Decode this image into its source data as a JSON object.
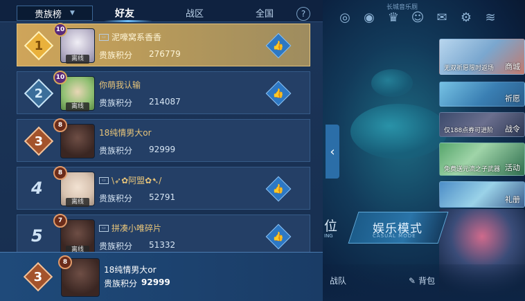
{
  "header": {
    "dropdown_label": "贵族榜",
    "tabs": [
      {
        "label": "好友",
        "active": true
      },
      {
        "label": "战区",
        "active": false
      },
      {
        "label": "全国",
        "active": false
      }
    ],
    "help_label": "?"
  },
  "rows": [
    {
      "rank": "1",
      "level": "10",
      "status": "离线",
      "name": "泥嚎窝系香香",
      "score_label": "贵族积分",
      "score": "276779",
      "has_flag": true
    },
    {
      "rank": "2",
      "level": "10",
      "status": "离线",
      "name": "你萌我认输",
      "score_label": "贵族积分",
      "score": "214087",
      "has_flag": false
    },
    {
      "rank": "3",
      "level": "8",
      "status": "",
      "name": "18纯情男大or",
      "score_label": "贵族积分",
      "score": "92999",
      "has_flag": false
    },
    {
      "rank": "4",
      "level": "8",
      "status": "离线",
      "name": "\\➶✿阿盟✿➷/",
      "score_label": "贵族积分",
      "score": "52791",
      "has_flag": true
    },
    {
      "rank": "5",
      "level": "7",
      "status": "离线",
      "name": "拼凑小唯碎片",
      "score_label": "贵族积分",
      "score": "51332",
      "has_flag": true
    }
  ],
  "my_rank": {
    "rank": "3",
    "level": "8",
    "name": "18纯情男大or",
    "score_label": "贵族积分",
    "score": "92999"
  },
  "game": {
    "top_label": "长城音乐厕",
    "panels": [
      {
        "caption": "无双祈愿限时返场",
        "label": "商城"
      },
      {
        "caption": "",
        "label": "祈愿"
      },
      {
        "caption": "仅188点券可进阶",
        "label": "战令"
      },
      {
        "caption": "免费送元流之子武器",
        "label": "活动"
      },
      {
        "caption": "",
        "label": "礼册"
      }
    ],
    "mode_left": "位",
    "mode_left_sub": "ING",
    "mode_main": "娱乐模式",
    "mode_sub": "CASUAL MODE",
    "bottom_items": [
      "战队",
      "背包"
    ]
  },
  "colors": {
    "panel_bg": "#1b3559",
    "gold_row": "#cfa55a",
    "accent_blue": "#2d78c4"
  }
}
